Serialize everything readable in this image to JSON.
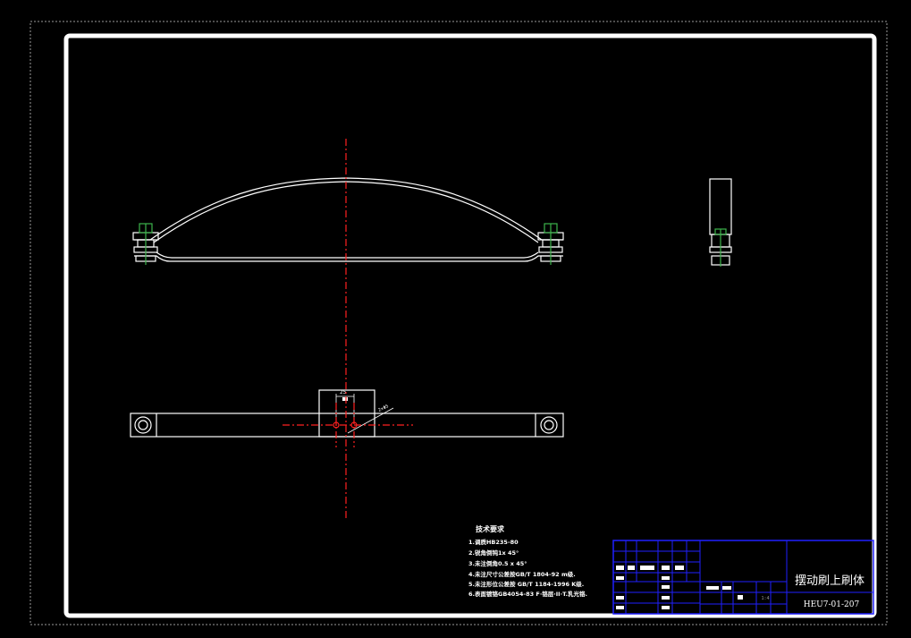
{
  "drawing": {
    "background": "#000000",
    "line_color": "#ffffff",
    "centerline_color": "#ff2020",
    "title_block_color": "#2020ff",
    "accent_green": "#3cb44b"
  },
  "dimensions": {
    "hole_spacing": "25",
    "angle_note": "2×Φ5"
  },
  "tech_requirements": {
    "title": "技术要求",
    "items": [
      "1.调质HB235-80",
      "2.锐角倒钝1x 45°",
      "3.未注倒角0.5 x 45°",
      "4.未注尺寸公差按GB/T 1804-92 m级.",
      "5.未注形位公差按 GB/T 1184-1996 K级.",
      "6.表面镀铬GB4054-83 F·铬层·II·T.乳光铬."
    ]
  },
  "title_block": {
    "part_name": "摆动刷上刷体",
    "drawing_number": "HEU7-01-207",
    "scale": "1:4"
  }
}
